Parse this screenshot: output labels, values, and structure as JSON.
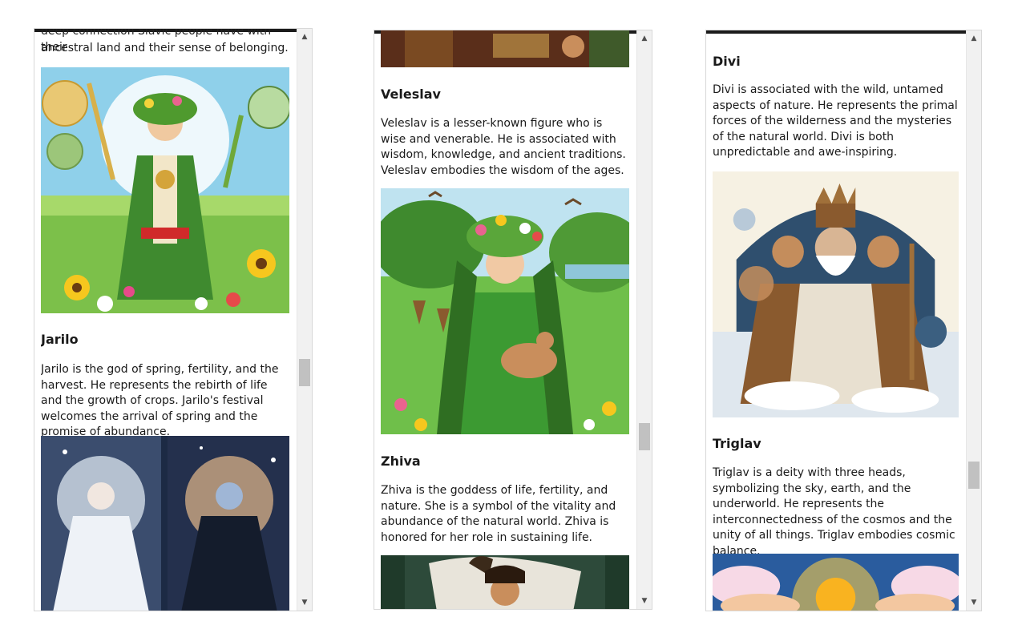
{
  "panels": [
    {
      "intro_line1": "deep connection Slavic people have with their",
      "intro_line2": "ancestral land and their sense of belonging.",
      "deity": {
        "name": "Jarilo",
        "description": "Jarilo is the god of spring, fertility, and the harvest. He represents the rebirth of life and the growth of crops. Jarilo's festival welcomes the arrival of spring and the promise of abundance."
      }
    },
    {
      "deities": [
        {
          "name": "Veleslav",
          "description": "Veleslav is a lesser-known figure who is wise and venerable. He is associated with wisdom, knowledge, and ancient traditions. Veleslav embodies the wisdom of the ages."
        },
        {
          "name": "Zhiva",
          "description": "Zhiva is the goddess of life, fertility, and nature. She is a symbol of the vitality and abundance of the natural world. Zhiva is honored for her role in sustaining life."
        }
      ]
    },
    {
      "deities": [
        {
          "name": "Divi",
          "description": "Divi is associated with the wild, untamed aspects of nature. He represents the primal forces of the wilderness and the mysteries of the natural world. Divi is both unpredictable and awe-inspiring."
        },
        {
          "name": "Triglav",
          "description": "Triglav is a deity with three heads, symbolizing the sky, earth, and the underworld. He represents the interconnectedness of the cosmos and the unity of all things. Triglav embodies cosmic balance."
        }
      ]
    }
  ],
  "scrollbar": {
    "up_arrow": "▲",
    "down_arrow": "▼"
  }
}
